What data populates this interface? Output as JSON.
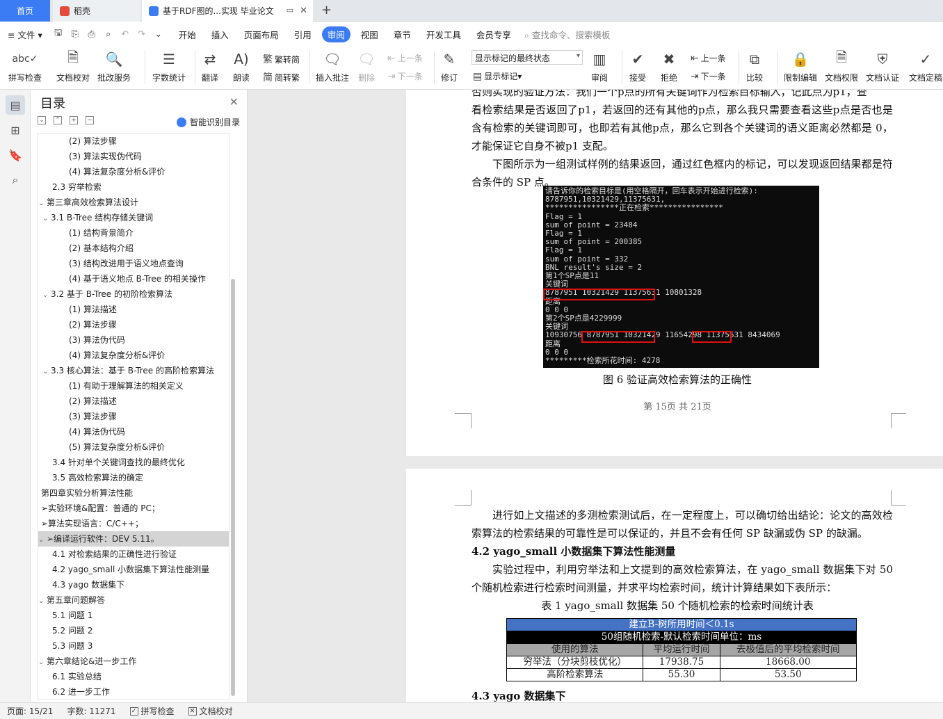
{
  "tabs": {
    "home": "首页",
    "daoke": "稻壳",
    "doc": "基于RDF图的...实现 毕业论文"
  },
  "menu": {
    "file": "文件",
    "items": [
      "开始",
      "插入",
      "页面布局",
      "引用",
      "审阅",
      "视图",
      "章节",
      "开发工具",
      "会员专享"
    ],
    "active_index": 4,
    "search": "查找命令、搜索模板"
  },
  "ribbon": {
    "spell": "拼写检查",
    "proof": "文档校对",
    "batch": "批改服务",
    "count": "字数统计",
    "translate": "翻译",
    "read": "朗读",
    "trad": "繁转简",
    "simp": "简转繁",
    "comment": "插入批注",
    "delete": "删除",
    "prev_c": "上一条",
    "next_c": "下一条",
    "revise": "修订",
    "markmode": "显示标记的最终状态",
    "showmark": "显示标记",
    "review": "审阅",
    "accept": "接受",
    "reject": "拒绝",
    "prev": "上一条",
    "next": "下一条",
    "compare": "比较",
    "restrict": "限制编辑",
    "rights": "文档权限",
    "cert": "文档认证",
    "finalize": "文档定稿"
  },
  "toc": {
    "title": "目录",
    "ai": "智能识别目录",
    "items": [
      {
        "t": "(2) 算法步骤",
        "lvl": 3
      },
      {
        "t": "(3) 算法实现伪代码",
        "lvl": 3
      },
      {
        "t": "(4) 算法复杂度分析&评价",
        "lvl": 3
      },
      {
        "t": "2.3 穷举检索",
        "lvl": 2
      },
      {
        "t": "第三章高效检索算法设计",
        "lvl": 1,
        "car": "v"
      },
      {
        "t": "3.1 B-Tree 结构存储关键词",
        "lvl": 2,
        "car": "v"
      },
      {
        "t": "(1) 结构背景简介",
        "lvl": 3
      },
      {
        "t": "(2) 基本结构介绍",
        "lvl": 3
      },
      {
        "t": "(3) 结构改进用于语义地点查询",
        "lvl": 3
      },
      {
        "t": "(4) 基于语义地点 B-Tree 的相关操作",
        "lvl": 3
      },
      {
        "t": "3.2 基于 B-Tree 的初阶检索算法",
        "lvl": 2,
        "car": "v"
      },
      {
        "t": "(1) 算法描述",
        "lvl": 3
      },
      {
        "t": "(2) 算法步骤",
        "lvl": 3
      },
      {
        "t": "(3) 算法伪代码",
        "lvl": 3
      },
      {
        "t": "(4) 算法复杂度分析&评价",
        "lvl": 3
      },
      {
        "t": "3.3 核心算法：基于 B-Tree 的高阶检索算法",
        "lvl": 2,
        "car": "v"
      },
      {
        "t": "(1) 有助于理解算法的相关定义",
        "lvl": 3
      },
      {
        "t": "(2) 算法描述",
        "lvl": 3
      },
      {
        "t": "(3) 算法步骤",
        "lvl": 3
      },
      {
        "t": "(4) 算法伪代码",
        "lvl": 3
      },
      {
        "t": "(5) 算法复杂度分析&评价",
        "lvl": 3
      },
      {
        "t": "3.4 针对单个关键词查找的最终优化",
        "lvl": 2
      },
      {
        "t": "3.5 高效检索算法的确定",
        "lvl": 2
      },
      {
        "t": "第四章实验分析算法性能",
        "lvl": 1
      },
      {
        "t": "➢实验环境&配置：普通的 PC；",
        "lvl": 1
      },
      {
        "t": "➢算法实现语言：C/C++；",
        "lvl": 1
      },
      {
        "t": "➢编译运行软件：DEV 5.11。",
        "lvl": 1,
        "car": "v",
        "sel": true
      },
      {
        "t": "4.1 对检索结果的正确性进行验证",
        "lvl": 2
      },
      {
        "t": "4.2 yago_small 小数据集下算法性能测量",
        "lvl": 2
      },
      {
        "t": "4.3 yago 数据集下",
        "lvl": 2
      },
      {
        "t": "第五章问题解答",
        "lvl": 1,
        "car": "v"
      },
      {
        "t": "5.1 问题 1",
        "lvl": 2
      },
      {
        "t": "5.2 问题 2",
        "lvl": 2
      },
      {
        "t": "5.3 问题 3",
        "lvl": 2
      },
      {
        "t": "第六章结论&进一步工作",
        "lvl": 1,
        "car": "v"
      },
      {
        "t": "6.1 实验总结",
        "lvl": 2
      },
      {
        "t": "6.2 进一步工作",
        "lvl": 2
      }
    ]
  },
  "page1": {
    "line0": "否则实现的验证方法：我们一个p点的所有关键词作为检索目标输入，记此点为p1，查",
    "para1": "看检索结果是否返回了p1，若返回的还有其他的p点，那么我只需要查看这些p点是否也是含有检索的关键词即可，也即若有其他p点，那么它到各个关键词的语义距离必然都是 0，才能保证它自身不被p1 支配。",
    "para2": "下图所示为一组测试样例的结果返回，通过红色框内的标记，可以发现返回结果都是符合条件的 SP 点。",
    "console": "请告诉你的检索目标是(用空格隔开，回车表示开始进行检索):\n8787951,10321429,11375631,\n****************正在检索****************\nFlag = 1\nsum of point = 23484\nFlag = 1\nsum of point = 200385\nFlag = 1\nsum of point = 332\nBNL result's size = 2\n第1个SP点是11\n关键词\n8787951 10321429 11375631 10801328\n距离\n0 0 0\n第2个SP点是4229999\n关键词\n10930756 8787951 10321429 11654298 11375631 8434069\n距离\n0 0 0\n*********检索所花时间: 4278",
    "caption": "图 6  验证高效检索算法的正确性",
    "pageno": "第 15页   共 21页"
  },
  "page2": {
    "para1": "进行如上文描述的多测检索测试后，在一定程度上，可以确切给出结论：论文的高效检索算法的检索结果的可靠性是可以保证的，并且不会有任何 SP 缺漏或伪 SP 的缺漏。",
    "h42": "4.2    yago_small 小数据集下算法性能测量",
    "para2": "实验过程中，利用穷举法和上文提到的高效检索算法，在 yago_small 数据集下对 50 个随机检索进行检索时间测量，并求平均检索时间，统计计算结果如下表所示：",
    "tcaption": "表 1 yago_small 数据集 50 个随机检索的检索时间统计表",
    "table": {
      "row1": "建立B-树所用时间＜0.1s",
      "row2": "50组随机检索-默认检索时间单位：ms",
      "head": [
        "使用的算法",
        "平均运行时间",
        "去极值后的平均检索时间"
      ],
      "rows": [
        [
          "穷举法（分块剪枝优化）",
          "17938.75",
          "18668.00"
        ],
        [
          "高阶检索算法",
          "55.30",
          "53.50"
        ]
      ]
    },
    "h43": "4.3 yago 数据集下"
  },
  "status": {
    "page": "页面: 15/21",
    "words": "字数: 11271",
    "spell": "拼写检查",
    "proof": "文档校对"
  },
  "colors": {
    "accent": "#3b7cf5",
    "table_head": "#4472c4",
    "red": "#e01010"
  }
}
